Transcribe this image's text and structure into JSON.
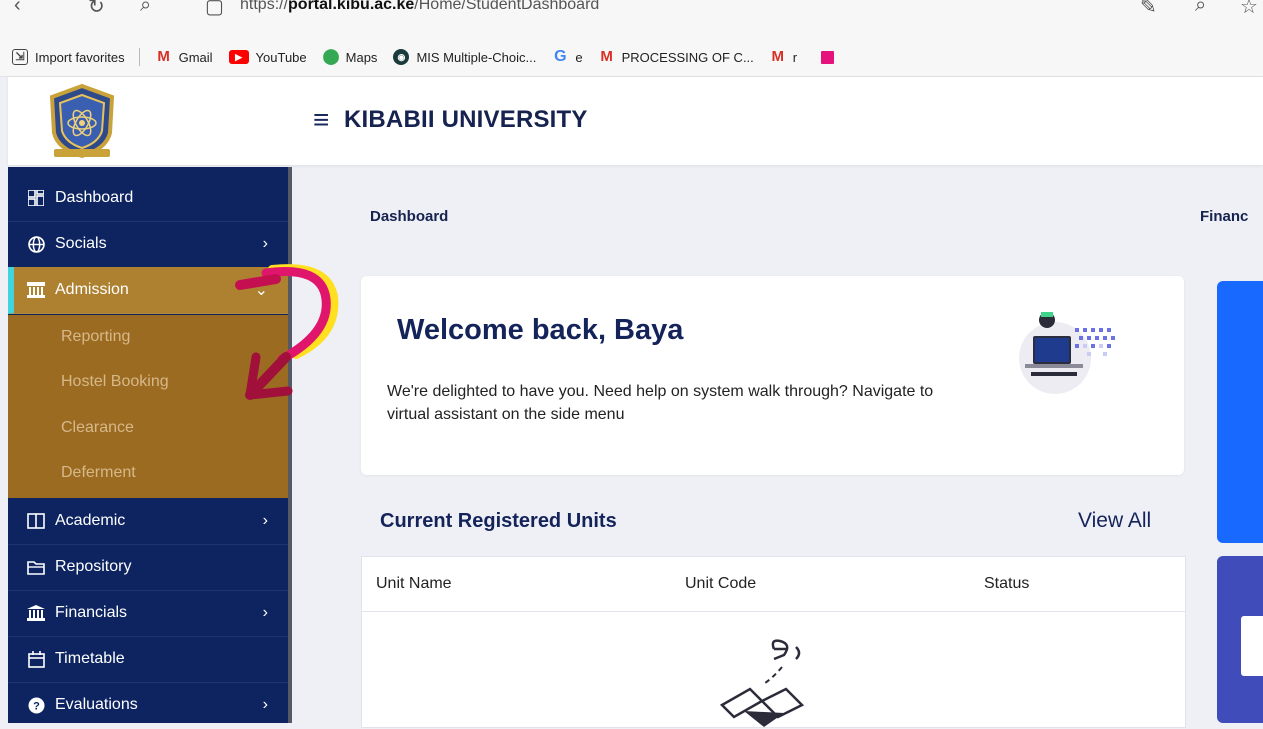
{
  "browser": {
    "url_prefix": "https://",
    "url_domain": "portal.kibu.ac.ke",
    "url_path": "/Home/StudentDashboard",
    "bookmarks": [
      {
        "label": "Import favorites"
      },
      {
        "label": "Gmail"
      },
      {
        "label": "YouTube"
      },
      {
        "label": "Maps"
      },
      {
        "label": "MIS Multiple-Choic..."
      },
      {
        "label": "e"
      },
      {
        "label": "PROCESSING OF C..."
      },
      {
        "label": "r"
      }
    ]
  },
  "header": {
    "title": "KIBABII UNIVERSITY"
  },
  "sidebar": {
    "items": [
      {
        "label": "Dashboard",
        "icon": "dashboard-grid-icon"
      },
      {
        "label": "Socials",
        "icon": "globe-icon"
      },
      {
        "label": "Admission",
        "icon": "institution-icon"
      },
      {
        "label": "Academic",
        "icon": "book-icon"
      },
      {
        "label": "Repository",
        "icon": "folder-icon"
      },
      {
        "label": "Financials",
        "icon": "bank-icon"
      },
      {
        "label": "Timetable",
        "icon": "calendar-icon"
      },
      {
        "label": "Evaluations",
        "icon": "question-circle-icon"
      }
    ],
    "admission_subitems": [
      "Reporting",
      "Hostel Booking",
      "Clearance",
      "Deferment"
    ]
  },
  "main": {
    "breadcrumb": "Dashboard",
    "right_label": "Financ",
    "welcome": {
      "title": "Welcome back, Baya",
      "text": "We're delighted to have you. Need help on system walk through? Navigate to virtual assistant on the side menu"
    },
    "units": {
      "title": "Current Registered Units",
      "view_all": "View All",
      "columns": [
        "Unit Name",
        "Unit Code",
        "Status"
      ]
    }
  },
  "colors": {
    "sidebar_bg": "#0d2461",
    "active_bg": "#ad8130",
    "submenu_bg": "#9b6b22",
    "accent": "#3fd4de",
    "brand_text": "#16224f",
    "blue_panel": "#1769ff",
    "indigo_panel": "#3f4cba"
  }
}
